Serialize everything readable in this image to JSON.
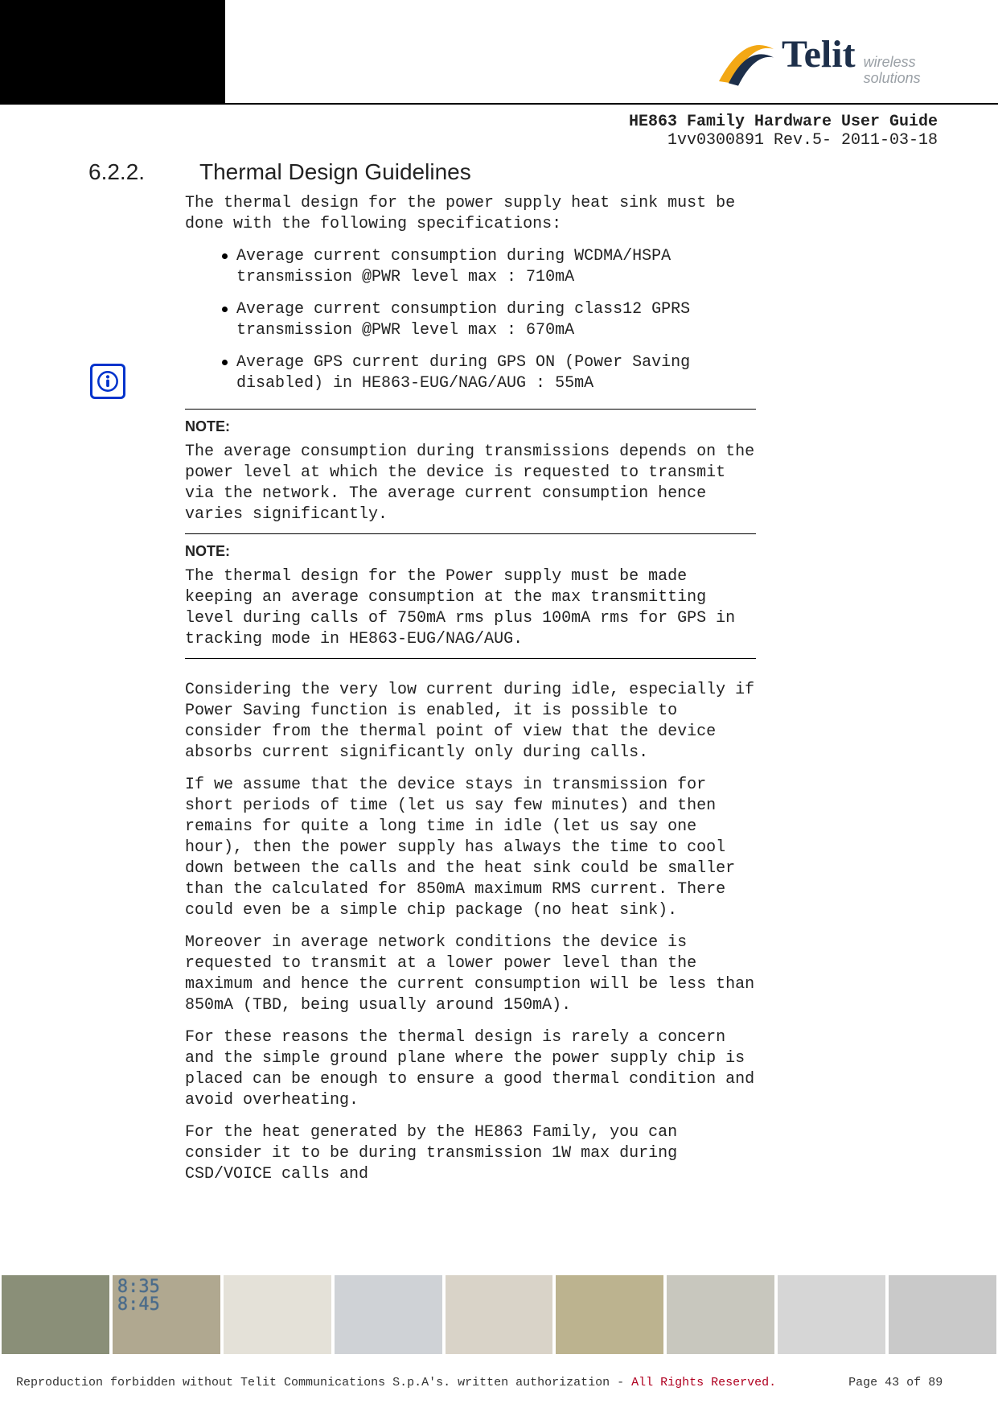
{
  "brand": {
    "name": "Telit",
    "tag1": "wireless",
    "tag2": "solutions"
  },
  "header": {
    "doc_title": "HE863 Family Hardware User Guide",
    "doc_rev": "1vv0300891 Rev.5- 2011-03-18"
  },
  "section": {
    "number": "6.2.2.",
    "title": "Thermal Design Guidelines"
  },
  "intro": "The thermal design for the power supply heat sink must be done with the following specifications:",
  "specs": [
    "Average current consumption during WCDMA/HSPA transmission @PWR level max : 710mA",
    "Average current consumption during class12 GPRS transmission @PWR level max : 670mA",
    "Average GPS current during GPS ON (Power Saving disabled) in HE863-EUG/NAG/AUG : 55mA"
  ],
  "notes": {
    "label": "NOTE:",
    "n1": "The average consumption during transmissions depends on the power level at which the device is requested to transmit via the network. The average current consumption hence varies significantly.",
    "n2": "The thermal design for the Power supply must be made keeping an average consumption at the max transmitting level during calls of 750mA rms plus 100mA rms for GPS in tracking mode in HE863-EUG/NAG/AUG."
  },
  "paras": {
    "p1": "Considering the very low current during idle, especially if Power Saving function is enabled, it is possible to consider from the thermal point of view that the device absorbs current significantly only during calls.",
    "p2": "If we assume that the device stays in transmission for short periods of time (let us say few minutes) and then remains for quite a long time in idle (let us say one hour), then the power supply has always the time to cool down between the calls and the heat sink could be smaller than the calculated for 850mA maximum RMS current. There could even be a simple chip package (no heat sink).",
    "p3": "Moreover in average network conditions the device is requested to transmit at a lower power level than the maximum and hence the current consumption will be less than 850mA (TBD, being usually around 150mA).",
    "p4": "For these reasons the thermal design is rarely a concern and the simple ground plane where the power supply chip is placed can be enough to ensure a good thermal condition and avoid overheating.",
    "p5": "For the heat generated by the HE863 Family, you can consider it to be during transmission 1W max during CSD/VOICE calls and"
  },
  "footer": {
    "line1a": "Reproduction forbidden without Telit Communications S.p.A's. written authorization - ",
    "line1b": "All Rights Reserved.",
    "page": "Page 43 of 89"
  },
  "digits": {
    "a": "8:35",
    "b": "8:45"
  }
}
